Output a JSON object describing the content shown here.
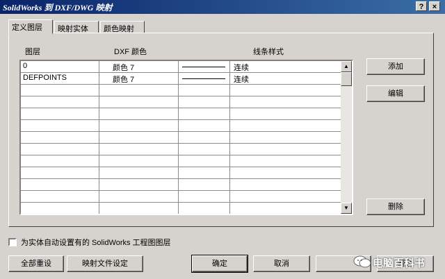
{
  "window": {
    "title": "SolidWorks 到 DXF/DWG 映射",
    "help_label": "?",
    "close_label": "×"
  },
  "tabs": [
    {
      "label": "定义图层"
    },
    {
      "label": "映射实体"
    },
    {
      "label": "颜色映射"
    }
  ],
  "table": {
    "headers": {
      "layer": "图层",
      "color": "DXF 颜色",
      "linestyle": "线条样式"
    },
    "rows": [
      {
        "layer": "0",
        "color": "颜色 7",
        "linestyle": "连续"
      },
      {
        "layer": "DEFPOINTS",
        "color": "颜色 7",
        "linestyle": "连续"
      }
    ]
  },
  "side_buttons": {
    "add": "添加",
    "edit": "编辑",
    "delete": "删除"
  },
  "checkbox": {
    "label": "为实体自动设置有的 SolidWorks 工程图图层",
    "checked": false
  },
  "footer_buttons": {
    "reset_all": "全部重设",
    "map_file": "映射文件设定",
    "ok": "确定",
    "cancel": "取消",
    "help": "帮助"
  },
  "watermark": {
    "text": "电脑百科书"
  }
}
